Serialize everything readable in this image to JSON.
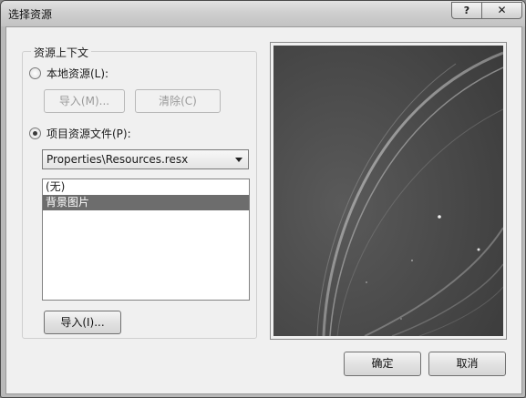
{
  "window": {
    "title": "选择资源",
    "help": "?",
    "close": "✕"
  },
  "group": {
    "label": "资源上下文",
    "local_radio": "本地资源(L):",
    "import_local": "导入(M)...",
    "clear": "清除(C)",
    "project_radio": "项目资源文件(P):",
    "resource_file": "Properties\\Resources.resx",
    "list_items": [
      "(无)",
      "背景图片"
    ],
    "import_project": "导入(I)..."
  },
  "footer": {
    "ok": "确定",
    "cancel": "取消"
  },
  "colors": {
    "selection": "#6d6d6d",
    "preview_bg": "#4a4a4a"
  }
}
